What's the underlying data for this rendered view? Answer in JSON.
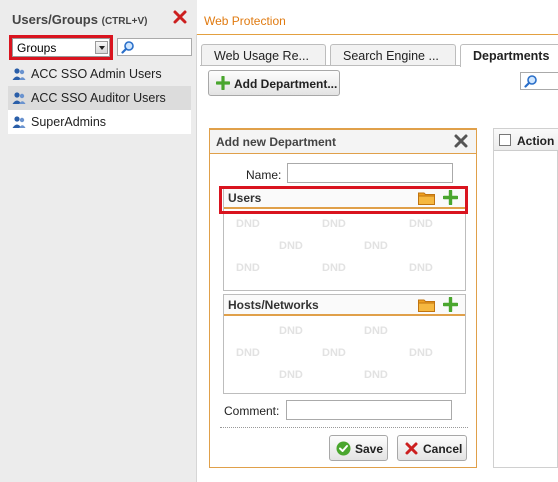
{
  "left_panel": {
    "title": "Users/Groups",
    "shortcut": "(CTRL+V)",
    "select_value": "Groups",
    "groups": [
      {
        "label": "ACC SSO Admin Users"
      },
      {
        "label": "ACC SSO Auditor Users"
      },
      {
        "label": "SuperAdmins"
      }
    ]
  },
  "main": {
    "title": "Web Protection",
    "tabs": [
      {
        "label": "Web Usage Re..."
      },
      {
        "label": "Search Engine ..."
      },
      {
        "label": "Departments"
      }
    ],
    "add_button": "Add Department..."
  },
  "dialog": {
    "title": "Add new Department",
    "name_label": "Name:",
    "name_value": "",
    "users_title": "Users",
    "hosts_title": "Hosts/Networks",
    "dnd_text": "DND",
    "comment_label": "Comment:",
    "comment_value": "",
    "save_label": "Save",
    "cancel_label": "Cancel"
  },
  "grid": {
    "action_header": "Action"
  },
  "colors": {
    "accent_orange": "#e07a10",
    "highlight_red": "#d9141f",
    "add_green": "#4aa62e",
    "close_red": "#cc1f1f",
    "user_blue": "#2a5ea8"
  }
}
